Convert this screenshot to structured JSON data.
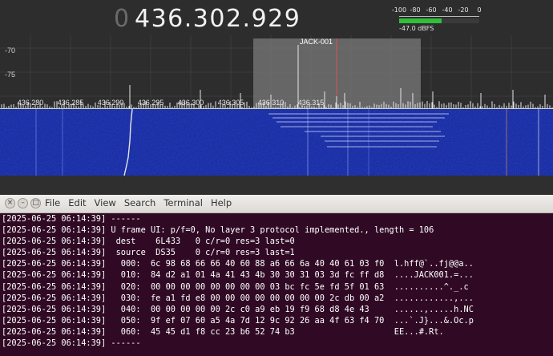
{
  "sdr": {
    "frequency_leading": "0",
    "frequency": "436.302.929",
    "smeter": {
      "ticks": [
        "-100",
        "-80",
        "-60",
        "-40",
        "-20",
        "0"
      ],
      "level_dbfs": -47.0,
      "reading": "-47.0 dBFS",
      "bar_color": "#2fbf3a"
    },
    "spectrum": {
      "y_ticks": [
        "-70",
        "-75"
      ],
      "x_ticks": [
        "436.280",
        "436.285",
        "436.290",
        "436.295",
        "436.300",
        "436.305",
        "436.310",
        "436.315"
      ],
      "marker_label": "JACK-001",
      "passband_color": "#7a7a7a",
      "center_line_color": "#e05050"
    },
    "waterfall_color": "#1a2a9c"
  },
  "terminal": {
    "title_buttons": [
      "×",
      "–",
      "□"
    ],
    "menu": [
      "File",
      "Edit",
      "View",
      "Search",
      "Terminal",
      "Help"
    ],
    "background_color": "#300a24",
    "lines": [
      "[2025-06-25 06:14:39] ------",
      "[2025-06-25 06:14:39] U frame UI: p/f=0, No layer 3 protocol implemented., length = 106",
      "[2025-06-25 06:14:39]  dest    6L433   0 c/r=0 res=3 last=0",
      "[2025-06-25 06:14:39]  source  DS35    0 c/r=0 res=3 last=1",
      "[2025-06-25 06:14:39]   000:  6c 98 68 66 66 40 60 88 a6 66 6a 40 40 61 03 f0  l.hff@`..fj@@a..",
      "[2025-06-25 06:14:39]   010:  84 d2 a1 01 4a 41 43 4b 30 30 31 03 3d fc ff d8  ....JACK001.=...",
      "[2025-06-25 06:14:39]   020:  00 00 00 00 00 00 00 00 03 bc fc 5e fd 5f 01 63  ..........^._.c",
      "[2025-06-25 06:14:39]   030:  fe a1 fd e8 00 00 00 00 00 00 00 00 2c db 00 a2  ............,...",
      "[2025-06-25 06:14:39]   040:  00 00 00 00 00 2c c0 a9 eb 19 f9 68 d8 4e 43     ......,.....h.NC",
      "[2025-06-25 06:14:39]   050:  9f ef 07 60 a5 4a 7d 12 9c 92 26 aa 4f 63 f4 70  ...`.J}...&.Oc.p",
      "[2025-06-25 06:14:39]   060:  45 45 d1 f8 cc 23 b6 52 74 b3                    EE...#.Rt.",
      "[2025-06-25 06:14:39] ------"
    ]
  }
}
